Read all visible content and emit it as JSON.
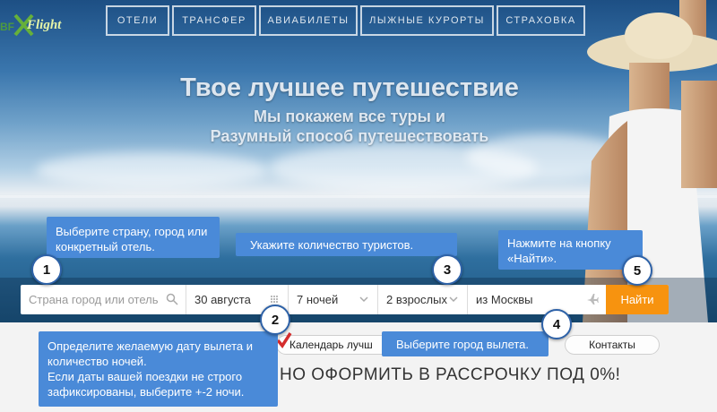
{
  "brand": {
    "logo_text": "Flight",
    "logo_prefix": "BF"
  },
  "nav": [
    {
      "label": "ОТЕЛИ"
    },
    {
      "label": "ТРАНСФЕР"
    },
    {
      "label": "АВИАБИЛЕТЫ"
    },
    {
      "label": "ЛЫЖНЫЕ КУРОРТЫ"
    },
    {
      "label": "СТРАХОВКА"
    }
  ],
  "hero": {
    "title": "Твое лучшее путешествие",
    "subtitle_line1": "Мы покажем все туры и",
    "subtitle_line2": "Разумный способ путешествовать"
  },
  "search": {
    "destination_placeholder": "Страна город или отель",
    "date": "30 августа",
    "nights": "7 ночей",
    "tourists": "2 взрослых",
    "departure": "из Москвы",
    "find_button": "Найти"
  },
  "tooltips": {
    "t1": "Выберите страну, город или конкретный отель.",
    "t2": "Определите желаемую дату вылета и количество ночей.\nЕсли даты вашей поездки не строго зафиксированы, выберите +-2 ночи.",
    "t3": "Укажите количество туристов.",
    "t4": "Выберите город вылета.",
    "t5": "Нажмите на кнопку «Найти»."
  },
  "badges": [
    "1",
    "2",
    "3",
    "4",
    "5"
  ],
  "lower": {
    "calendar_label": "Календарь лучш",
    "contacts_label": "Контакты",
    "banner_text": "НО ОФОРМИТЬ В РАССРОЧКУ ПОД 0%!"
  },
  "colors": {
    "accent": "#f7930f",
    "tooltip": "#4a8ad8",
    "badge_border": "#2e62a8"
  }
}
